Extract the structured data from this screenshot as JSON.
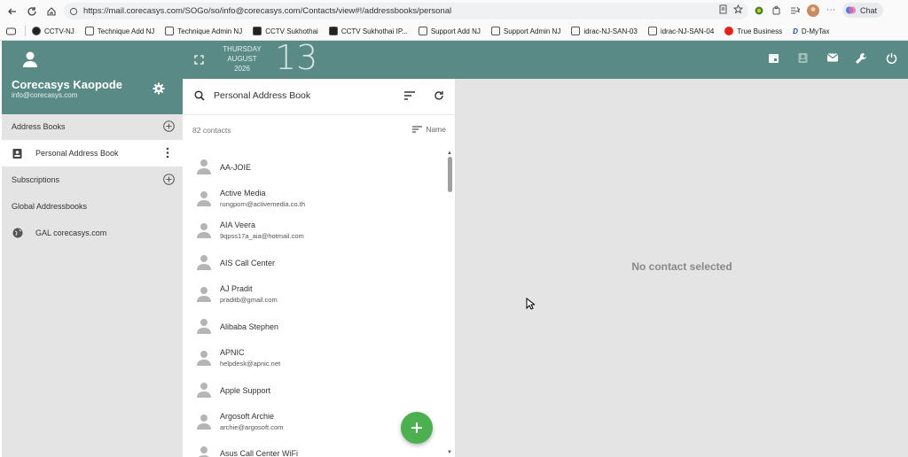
{
  "browser": {
    "url": "https://mail.corecasys.com/SOGo/so/info@corecasys.com/Contacts/view#!/addressbooks/personal",
    "chat_label": "Chat"
  },
  "bookmarks": [
    {
      "label": "CCTV-NJ",
      "icon": "camera-icon"
    },
    {
      "label": "Technique Add NJ",
      "icon": "page-icon"
    },
    {
      "label": "Technique Admin NJ",
      "icon": "page-icon"
    },
    {
      "label": "CCTV Sukhothai",
      "icon": "camera-icon"
    },
    {
      "label": "CCTV Sukhothai IP...",
      "icon": "camera-icon"
    },
    {
      "label": "Support Add NJ",
      "icon": "page-icon"
    },
    {
      "label": "Support Admin NJ",
      "icon": "page-icon"
    },
    {
      "label": "idrac-NJ-SAN-03",
      "icon": "server-icon"
    },
    {
      "label": "idrac-NJ-SAN-04",
      "icon": "server-icon"
    },
    {
      "label": "True Business",
      "icon": "brand-icon"
    },
    {
      "label": "D-MyTax",
      "icon": "d-icon"
    }
  ],
  "user": {
    "name": "Corecasys Kaopode",
    "email": "info@corecasys.com"
  },
  "date": {
    "weekday": "THURSDAY",
    "month": "AUGUST",
    "year": "2026",
    "day": "13"
  },
  "sidebar": {
    "address_books_label": "Address Books",
    "personal_label": "Personal Address Book",
    "subscriptions_label": "Subscriptions",
    "global_label": "Global Addressbooks",
    "gal_label": "GAL corecasys.com"
  },
  "list": {
    "title": "Personal Address Book",
    "count_label": "82 contacts",
    "sort_label": "Name",
    "contacts": [
      {
        "name": "AA-JOIE",
        "email": ""
      },
      {
        "name": "Active Media",
        "email": "rungporn@activemedia.co.th"
      },
      {
        "name": "AIA Veera",
        "email": "9qpss17a_aia@hotmail.com"
      },
      {
        "name": "AIS Call Center",
        "email": ""
      },
      {
        "name": "AJ Pradit",
        "email": "praditb@gmail.com"
      },
      {
        "name": "Alibaba Stephen",
        "email": ""
      },
      {
        "name": "APNIC",
        "email": "helpdesk@apnic.net"
      },
      {
        "name": "Apple Support",
        "email": ""
      },
      {
        "name": "Argosoft Archie",
        "email": "archie@argosoft.com"
      },
      {
        "name": "Asus Call Center WiFi",
        "email": ""
      }
    ]
  },
  "detail": {
    "empty_message": "No contact selected"
  },
  "colors": {
    "accent": "#5a8a86",
    "fab": "#4caf50",
    "sidebar_bg": "#e4e4e4"
  }
}
